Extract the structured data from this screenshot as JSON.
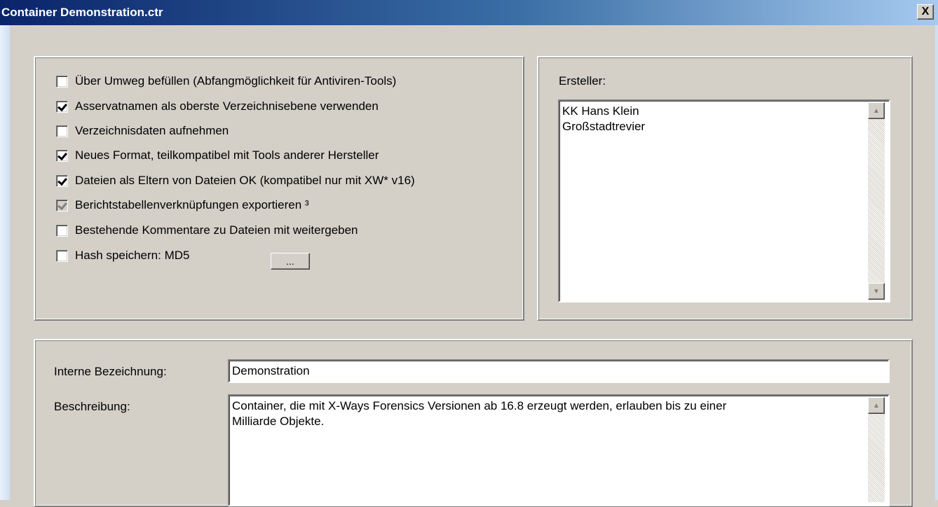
{
  "window": {
    "title": "Container Demonstration.ctr",
    "close_label": "X"
  },
  "options": [
    {
      "label": "Über Umweg befüllen (Abfangmöglichkeit für Antiviren-Tools)",
      "checked": false,
      "disabled": false
    },
    {
      "label": "Asservatnamen als oberste Verzeichnisebene verwenden",
      "checked": true,
      "disabled": false
    },
    {
      "label": "Verzeichnisdaten aufnehmen",
      "checked": false,
      "disabled": false
    },
    {
      "label": "Neues Format, teilkompatibel mit Tools anderer Hersteller",
      "checked": true,
      "disabled": false
    },
    {
      "label": "Dateien als Eltern von Dateien OK (kompatibel nur mit XW* v16)",
      "checked": true,
      "disabled": false
    },
    {
      "label": "Berichtstabellenverknüpfungen exportieren ³",
      "checked": true,
      "disabled": true
    },
    {
      "label": "Bestehende Kommentare zu Dateien mit weitergeben",
      "checked": false,
      "disabled": false
    },
    {
      "label": "Hash speichern: MD5",
      "checked": false,
      "disabled": false
    }
  ],
  "hash_button_label": "...",
  "creator": {
    "label": "Ersteller:",
    "text": "KK Hans Klein\nGroßstadtrevier"
  },
  "internal_name": {
    "label": "Interne Bezeichnung:",
    "value": "Demonstration"
  },
  "description": {
    "label": "Beschreibung:",
    "value": "Container, die mit X-Ways Forensics Versionen ab 16.8 erzeugt werden, erlauben bis zu einer\nMilliarde Objekte."
  },
  "scroll_icons": {
    "up": "▲",
    "down": "▼"
  }
}
